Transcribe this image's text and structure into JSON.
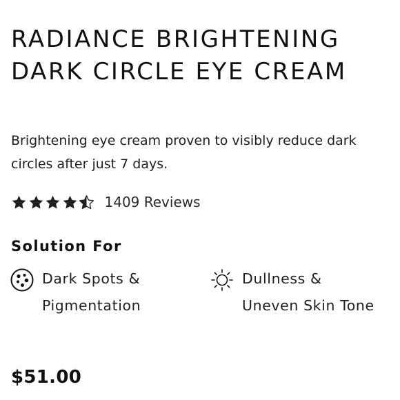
{
  "product": {
    "title": "RADIANCE BRIGHTENING DARK CIRCLE EYE CREAM",
    "description": "Brightening eye cream proven to visibly reduce dark circles after just 7 days.",
    "rating": 4.5,
    "rating_max": 5,
    "reviews_label": "1409 Reviews",
    "price": "$51.00"
  },
  "solutions": {
    "heading": "Solution For",
    "items": [
      {
        "label": "Dark Spots & Pigmentation",
        "icon": "dark-spots-icon"
      },
      {
        "label": "Dullness & Uneven Skin Tone",
        "icon": "sun-icon"
      }
    ]
  },
  "colors": {
    "text": "#111111",
    "background": "#ffffff"
  }
}
